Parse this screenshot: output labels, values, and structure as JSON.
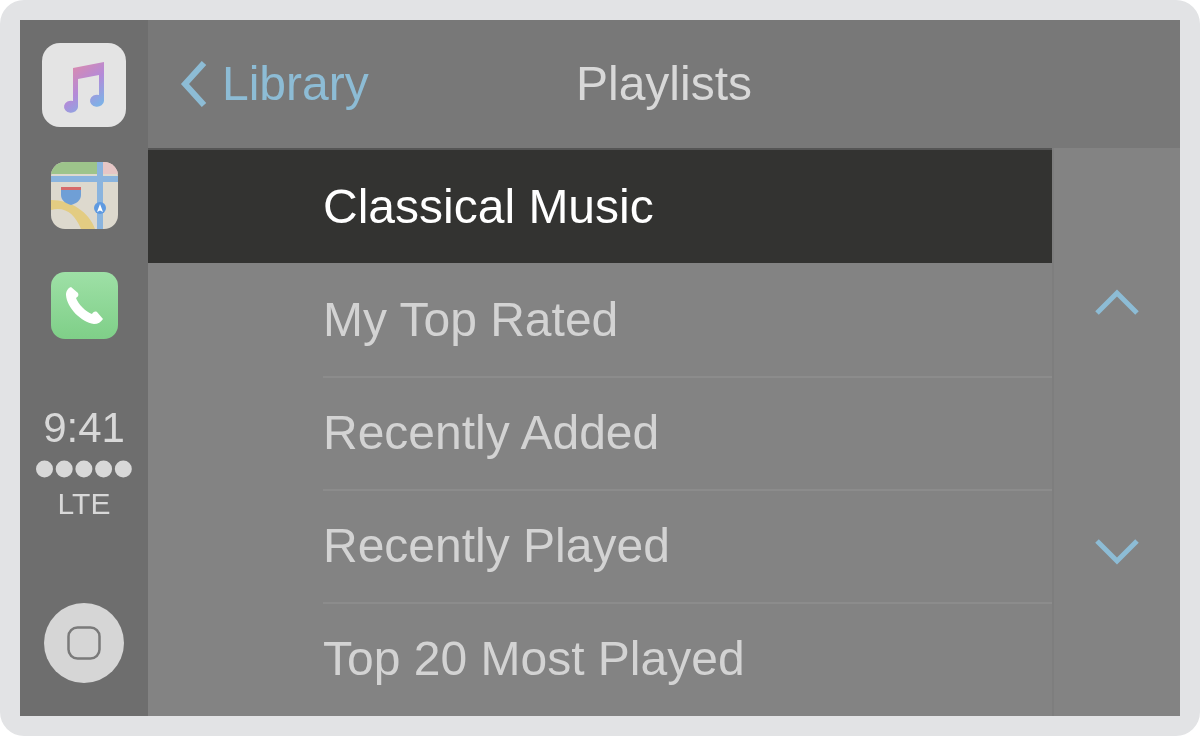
{
  "status": {
    "time": "9:41",
    "network": "LTE"
  },
  "nav_bar": {
    "back_label": "Library",
    "title": "Playlists"
  },
  "playlists": [
    {
      "name": "Classical Music",
      "selected": true
    },
    {
      "name": "My Top Rated",
      "selected": false
    },
    {
      "name": "Recently Added",
      "selected": false
    },
    {
      "name": "Recently Played",
      "selected": false
    },
    {
      "name": "Top 20 Most Played",
      "selected": false
    }
  ]
}
